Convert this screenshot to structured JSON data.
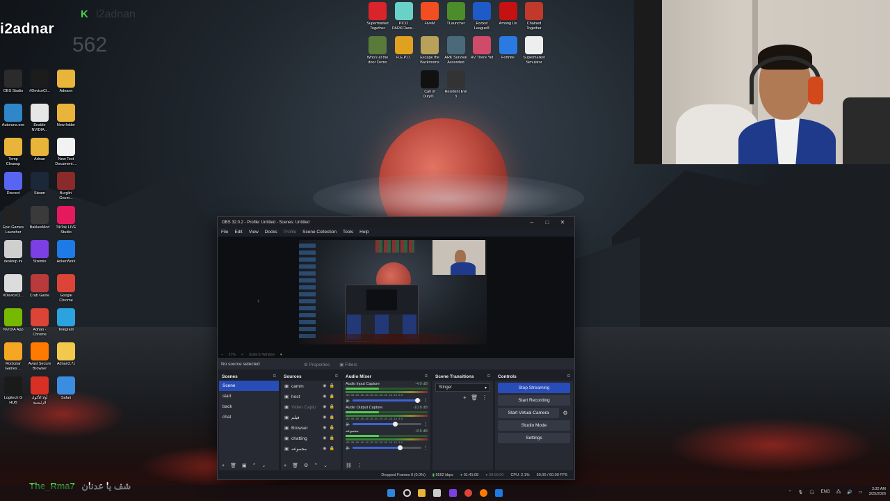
{
  "overlay": {
    "streamer_name": "i2adnar",
    "k_badge": "K",
    "faint_name": "i2adnan",
    "faint_number": "562",
    "bottom_name": "The_Rma7",
    "bottom_arabic": "شف يا عدنان",
    "accent": "#4bd14b"
  },
  "desktop_left": [
    {
      "label": "OBS Studio",
      "icon": "obs-icon",
      "color": "#2b2b2b"
    },
    {
      "label": "#DeviceCl...",
      "icon": "device-cleanup-icon",
      "color": "#1c1c1c"
    },
    {
      "label": "Adnann",
      "icon": "folder-icon",
      "color": "#e8b43a"
    },
    {
      "label": "Autoruns.exe",
      "icon": "autoruns-icon",
      "color": "#2f86c9"
    },
    {
      "label": "Enable\nNVIDIA...",
      "icon": "file-icon",
      "color": "#e6e6e6"
    },
    {
      "label": "New folder",
      "icon": "folder-icon",
      "color": "#e8b43a"
    },
    {
      "label": "Temp\nCleanup",
      "icon": "folder-icon",
      "color": "#e8b43a"
    },
    {
      "label": "Adnan",
      "icon": "folder-icon",
      "color": "#e8b43a"
    },
    {
      "label": "New Text\nDocument....",
      "icon": "text-file-icon",
      "color": "#f2f2f2"
    },
    {
      "label": "Discord",
      "icon": "discord-icon",
      "color": "#5865f2"
    },
    {
      "label": "Steam",
      "icon": "steam-icon",
      "color": "#1b2838"
    },
    {
      "label": "Burglin'\nGnom...",
      "icon": "game-icon",
      "color": "#8b2a2a"
    },
    {
      "label": "Epic Games\nLauncher",
      "icon": "epic-icon",
      "color": "#222"
    },
    {
      "label": "BakkesMod",
      "icon": "bakkesmod-icon",
      "color": "#3a3a3a"
    },
    {
      "label": "TikTok LIVE\nStudio",
      "icon": "tiktok-icon",
      "color": "#e5195e"
    },
    {
      "label": "desktop.ini",
      "icon": "ini-file-icon",
      "color": "#cfcfcf"
    },
    {
      "label": "Stremio",
      "icon": "stremio-icon",
      "color": "#7b3fe4"
    },
    {
      "label": "AnkerWork",
      "icon": "ankerwork-icon",
      "color": "#1e7ae6"
    },
    {
      "label": "#DeviceCl...",
      "icon": "device-cleanup-icon",
      "color": "#dcdcdc"
    },
    {
      "label": "Crab Game",
      "icon": "crab-game-icon",
      "color": "#b93a3a"
    },
    {
      "label": "Google\nChrome",
      "icon": "chrome-icon",
      "color": "#db4437"
    },
    {
      "label": "NVIDIA App",
      "icon": "nvidia-icon",
      "color": "#76b900"
    },
    {
      "label": "Adnan -\nChrome",
      "icon": "chrome-icon",
      "color": "#db4437"
    },
    {
      "label": "Telegram",
      "icon": "telegram-icon",
      "color": "#2aa3df"
    },
    {
      "label": "Rockstar\nGames ...",
      "icon": "rockstar-icon",
      "color": "#f5a623"
    },
    {
      "label": "Avast Secure\nBrowser",
      "icon": "avast-icon",
      "color": "#ff7a00"
    },
    {
      "label": "Adnan3.7z",
      "icon": "archive-icon",
      "color": "#f2c94c"
    },
    {
      "label": "Logitech G\nHUB",
      "icon": "logitech-icon",
      "color": "#1a1a1a"
    },
    {
      "label": "أولا الأكواد\nالرئيسية",
      "icon": "pdf-icon",
      "color": "#d93025"
    },
    {
      "label": "Safari",
      "icon": "safari-icon",
      "color": "#3a8de0"
    }
  ],
  "desktop_top": [
    {
      "label": "Supermarket\nTogether",
      "icon": "supermarket-icon",
      "color": "#d8242a"
    },
    {
      "label": "PICO\nPARKClass...",
      "icon": "pico-park-icon",
      "color": "#6ad1c9"
    },
    {
      "label": "FiveM",
      "icon": "fivem-icon",
      "color": "#f24e22"
    },
    {
      "label": "TLauncher",
      "icon": "tlauncher-icon",
      "color": "#4c8c2b"
    },
    {
      "label": "Rocket\nLeague®",
      "icon": "rocket-league-icon",
      "color": "#1e5ac8"
    },
    {
      "label": "Among Us",
      "icon": "among-us-icon",
      "color": "#c51111"
    },
    {
      "label": "Chained\nTogether",
      "icon": "chained-together-icon",
      "color": "#c0392b"
    },
    {
      "label": "Who's at the\ndoor Demo",
      "icon": "game-icon",
      "color": "#5a7a3a"
    },
    {
      "label": "R.E.P.O.",
      "icon": "repo-icon",
      "color": "#e0a020"
    },
    {
      "label": "Escape the\nBackrooms",
      "icon": "backrooms-icon",
      "color": "#b8a25a"
    },
    {
      "label": "ARK Survival\nAscended",
      "icon": "ark-icon",
      "color": "#4a6a7a"
    },
    {
      "label": "RV There Yet",
      "icon": "rv-icon",
      "color": "#d04a6a"
    },
    {
      "label": "Fortnite",
      "icon": "fortnite-icon",
      "color": "#2a7ae2"
    },
    {
      "label": "Supermarket\nSimulator",
      "icon": "supermarket-sim-icon",
      "color": "#eeeeee"
    },
    {
      "label": "Call of\nDuty®...",
      "icon": "cod-icon",
      "color": "#111"
    },
    {
      "label": "Resident Evil\n3",
      "icon": "re3-icon",
      "color": "#333"
    }
  ],
  "obs": {
    "title": "OBS 32.0.2 - Profile: Untitled - Scenes: Untitled",
    "menu": [
      "File",
      "Edit",
      "View",
      "Docks",
      "Profile",
      "Scene Collection",
      "Tools",
      "Help"
    ],
    "preview_zoom": "27%",
    "preview_mode": "Scale to Window",
    "no_source": "No source selected",
    "properties": "Properties",
    "filters": "Filters",
    "scenes_title": "Scenes",
    "scenes": [
      {
        "name": "Scene",
        "selected": true
      },
      {
        "name": "start",
        "selected": false
      },
      {
        "name": "back",
        "selected": false
      },
      {
        "name": "chat",
        "selected": false
      }
    ],
    "sources_title": "Sources",
    "sources": [
      {
        "name": "camm",
        "dim": false
      },
      {
        "name": "host",
        "dim": false
      },
      {
        "name": "Video Captu",
        "dim": true
      },
      {
        "name": "فيلم",
        "dim": false
      },
      {
        "name": "Browser",
        "dim": false
      },
      {
        "name": "chatting",
        "dim": false
      },
      {
        "name": "مجموعه",
        "dim": false
      }
    ],
    "mixer_title": "Audio Mixer",
    "mixer": [
      {
        "name": "Audio Input Capture",
        "db": "-4.0 dB",
        "volume": 0.95
      },
      {
        "name": "Audio Output Capture",
        "db": "-10.8 dB",
        "volume": 0.62
      },
      {
        "name": "مجموعه",
        "db": "-8.5 dB",
        "volume": 0.7
      }
    ],
    "meter_scale": "-60 -55 -50 -45 -40 -35 -30 -25 -20 -15 -10 -5 0",
    "transitions_title": "Scene Transitions",
    "transition": "Stinger",
    "controls_title": "Controls",
    "controls": {
      "stop_streaming": "Stop Streaming",
      "start_recording": "Start Recording",
      "start_virtual_camera": "Start Virtual Camera",
      "studio_mode": "Studio Mode",
      "settings": "Settings"
    },
    "status": {
      "dropped": "Dropped Frames 0 (0.0%)",
      "bitrate": "5562 kbps",
      "live_time": "01:41:08",
      "rec_time": "00:00:00",
      "cpu": "CPU: 2.1%",
      "fps": "60.00 / 60.00 FPS"
    },
    "accent": "#284cb8"
  },
  "tray": {
    "lang": "ENG",
    "time": "3:32 AM",
    "date": "3/25/2026"
  }
}
